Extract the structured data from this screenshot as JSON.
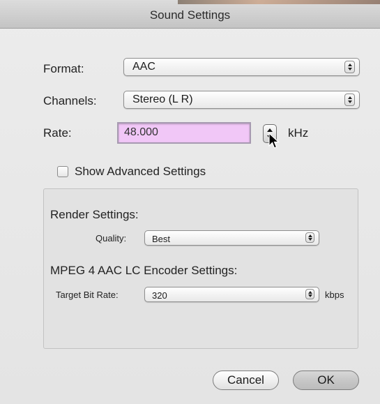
{
  "window": {
    "title": "Sound Settings"
  },
  "format": {
    "label": "Format:",
    "value": "AAC"
  },
  "channels": {
    "label": "Channels:",
    "value": "Stereo (L R)"
  },
  "rate": {
    "label": "Rate:",
    "value": "48.000",
    "unit": "kHz"
  },
  "advanced": {
    "label": "Show Advanced Settings",
    "checked": false
  },
  "render": {
    "heading": "Render Settings:",
    "quality_label": "Quality:",
    "quality_value": "Best"
  },
  "encoder": {
    "heading": "MPEG 4 AAC LC Encoder Settings:",
    "bitrate_label": "Target Bit Rate:",
    "bitrate_value": "320",
    "bitrate_unit": "kbps"
  },
  "buttons": {
    "cancel": "Cancel",
    "ok": "OK"
  },
  "colors": {
    "rate_field_bg": "#f1c7f7"
  }
}
